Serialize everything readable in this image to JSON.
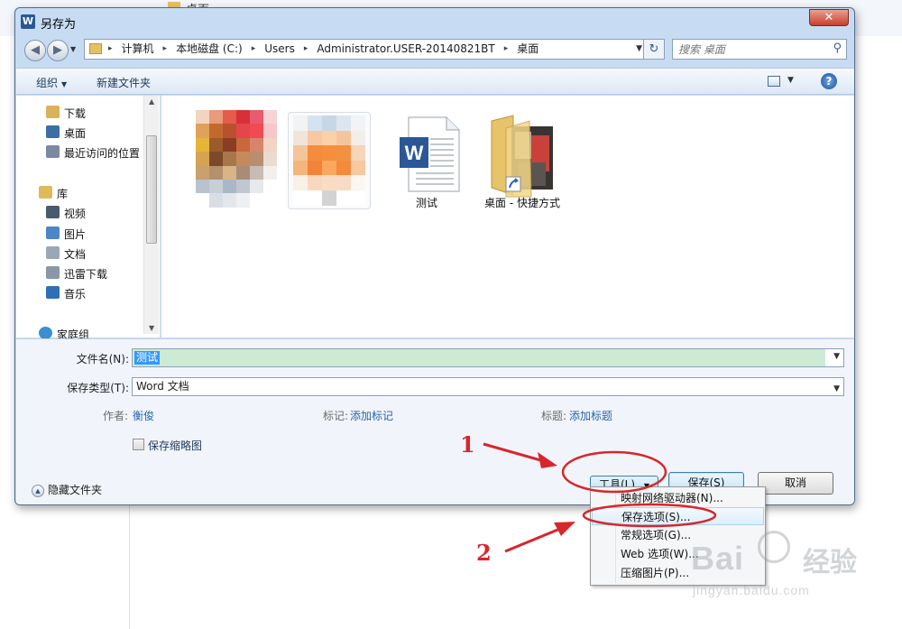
{
  "background": {
    "top_item": "桌面"
  },
  "dialog": {
    "title": "另存为",
    "app_icon": "W",
    "close_glyph": "✕"
  },
  "address_bar": {
    "parts": [
      "计算机",
      "本地磁盘 (C:)",
      "Users",
      "Administrator.USER-20140821BT",
      "桌面"
    ],
    "separator": "▸"
  },
  "search": {
    "placeholder": "搜索 桌面"
  },
  "toolbar": {
    "organize": "组织",
    "new_folder": "新建文件夹"
  },
  "nav_pane": {
    "items": [
      {
        "label": "下载",
        "icon": "download-folder-icon",
        "color": "#d9b25a"
      },
      {
        "label": "桌面",
        "icon": "desktop-icon",
        "color": "#3a6ea5"
      },
      {
        "label": "最近访问的位置",
        "icon": "recent-places-icon",
        "color": "#7a8aa0"
      },
      {
        "label": "库",
        "icon": "library-icon",
        "color": "#e0b95a"
      },
      {
        "label": "视频",
        "icon": "video-icon",
        "color": "#4b5b6e"
      },
      {
        "label": "图片",
        "icon": "pictures-icon",
        "color": "#4c86c6"
      },
      {
        "label": "文档",
        "icon": "documents-icon",
        "color": "#9aa7b5"
      },
      {
        "label": "迅雷下载",
        "icon": "thunder-download-icon",
        "color": "#8a97a8"
      },
      {
        "label": "音乐",
        "icon": "music-icon",
        "color": "#2f6fb5"
      },
      {
        "label": "家庭组",
        "icon": "homegroup-icon",
        "color": "#3b8fd0"
      }
    ]
  },
  "files": [
    {
      "label": "",
      "icon": "blurred-image-icon"
    },
    {
      "label": "",
      "icon": "blurred-image-icon"
    },
    {
      "label": "测试",
      "icon": "word-document-icon"
    },
    {
      "label": "桌面 - 快捷方式",
      "icon": "folder-shortcut-icon"
    }
  ],
  "form": {
    "filename_label": "文件名(N):",
    "filename_value": "测试",
    "filetype_label": "保存类型(T):",
    "filetype_value": "Word 文档",
    "author_label": "作者:",
    "author_value": "衡俊",
    "tags_label": "标记:",
    "tags_value": "添加标记",
    "title_label": "标题:",
    "title_value": "添加标题",
    "thumbnail_label": "保存缩略图",
    "hide_folders": "隐藏文件夹"
  },
  "buttons": {
    "tools": "工具(L)",
    "save": "保存(S)",
    "cancel": "取消"
  },
  "tools_menu": {
    "items": [
      "映射网络驱动器(N)...",
      "保存选项(S)...",
      "常规选项(G)...",
      "Web 选项(W)...",
      "压缩图片(P)..."
    ],
    "highlighted_index": 1
  },
  "annotations": {
    "step1": "1",
    "step2": "2",
    "color": "#d7262c"
  },
  "watermark": {
    "brand": "Bai",
    "cn": "经验",
    "url": "jingyan.baidu.com"
  }
}
